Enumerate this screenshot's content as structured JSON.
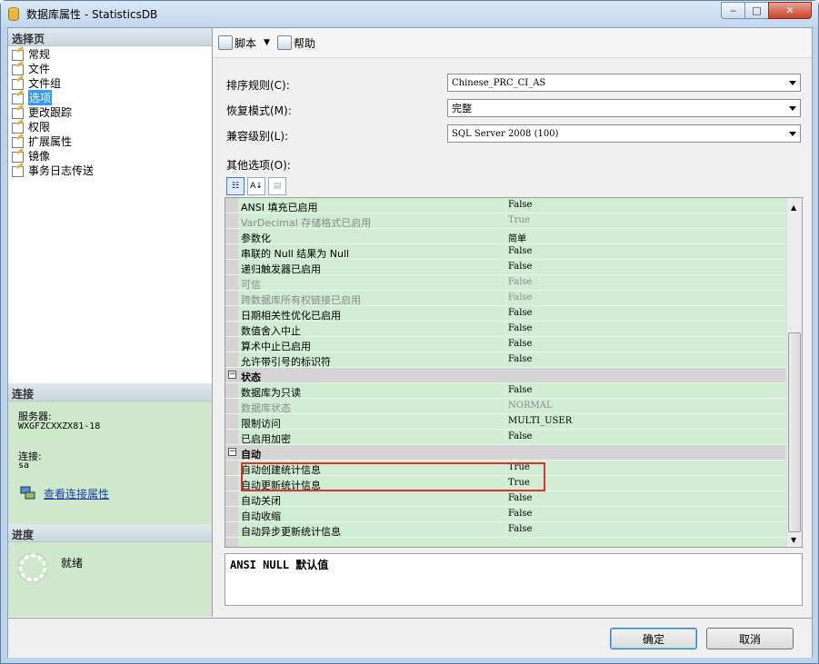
{
  "window": {
    "title": "数据库属性 - StatisticsDB"
  },
  "caption_buttons": {
    "minimize": "‒",
    "maximize": "□",
    "close": "✕"
  },
  "left": {
    "select_page_header": "选择页",
    "pages": [
      {
        "label": "常规",
        "selected": false
      },
      {
        "label": "文件",
        "selected": false
      },
      {
        "label": "文件组",
        "selected": false
      },
      {
        "label": "选项",
        "selected": true
      },
      {
        "label": "更改跟踪",
        "selected": false
      },
      {
        "label": "权限",
        "selected": false
      },
      {
        "label": "扩展属性",
        "selected": false
      },
      {
        "label": "镜像",
        "selected": false
      },
      {
        "label": "事务日志传送",
        "selected": false
      }
    ],
    "connection_header": "连接",
    "server_label": "服务器:",
    "server_value": "WXGFZCXXZX81-18",
    "connection_label": "连接:",
    "connection_value": "sa",
    "view_conn_props": "查看连接属性",
    "progress_header": "进度",
    "progress_status": "就绪"
  },
  "toolbar": {
    "script": "脚本",
    "help": "帮助"
  },
  "fields": {
    "collation_label": "排序规则(C):",
    "collation_value": "Chinese_PRC_CI_AS",
    "recovery_label": "恢复模式(M):",
    "recovery_value": "完整",
    "compat_label": "兼容级别(L):",
    "compat_value": "SQL Server 2008 (100)",
    "other_label": "其他选项(O):"
  },
  "grid": {
    "rows": [
      {
        "type": "prop",
        "name": "ANSI 填充已启用",
        "value": "False"
      },
      {
        "type": "prop",
        "name": "VarDecimal 存储格式已启用",
        "value": "True",
        "disabled": true
      },
      {
        "type": "prop",
        "name": "参数化",
        "value": "简单"
      },
      {
        "type": "prop",
        "name": "串联的 Null 结果为 Null",
        "value": "False"
      },
      {
        "type": "prop",
        "name": "递归触发器已启用",
        "value": "False"
      },
      {
        "type": "prop",
        "name": "可信",
        "value": "False",
        "disabled": true
      },
      {
        "type": "prop",
        "name": "跨数据库所有权链接已启用",
        "value": "False",
        "disabled": true
      },
      {
        "type": "prop",
        "name": "日期相关性优化已启用",
        "value": "False"
      },
      {
        "type": "prop",
        "name": "数值舍入中止",
        "value": "False"
      },
      {
        "type": "prop",
        "name": "算术中止已启用",
        "value": "False"
      },
      {
        "type": "prop",
        "name": "允许带引号的标识符",
        "value": "False"
      },
      {
        "type": "cat",
        "name": "状态",
        "toggle": "−"
      },
      {
        "type": "prop",
        "name": "数据库为只读",
        "value": "False"
      },
      {
        "type": "prop",
        "name": "数据库状态",
        "value": "NORMAL",
        "disabled": true
      },
      {
        "type": "prop",
        "name": "限制访问",
        "value": "MULTI_USER"
      },
      {
        "type": "prop",
        "name": "已启用加密",
        "value": "False"
      },
      {
        "type": "cat",
        "name": "自动",
        "toggle": "−"
      },
      {
        "type": "prop",
        "name": "自动创建统计信息",
        "value": "True"
      },
      {
        "type": "prop",
        "name": "自动更新统计信息",
        "value": "True"
      },
      {
        "type": "prop",
        "name": "自动关闭",
        "value": "False"
      },
      {
        "type": "prop",
        "name": "自动收缩",
        "value": "False"
      },
      {
        "type": "prop",
        "name": "自动异步更新统计信息",
        "value": "False"
      }
    ]
  },
  "description": "ANSI NULL 默认值",
  "buttons": {
    "ok": "确定",
    "cancel": "取消"
  },
  "colors": {
    "grid_bg": "#d0ecd3",
    "selected": "#3399ff",
    "highlight_box": "#e03030"
  }
}
